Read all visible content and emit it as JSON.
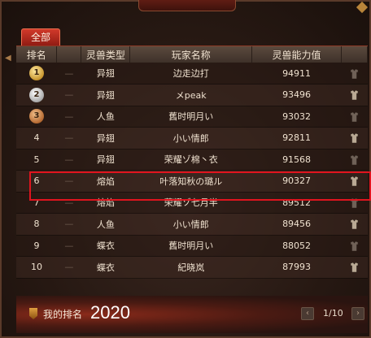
{
  "tabs": [
    {
      "label": "全部"
    }
  ],
  "table": {
    "headers": {
      "rank": "排名",
      "type": "灵兽类型",
      "player": "玩家名称",
      "power": "灵兽能力值"
    },
    "rows": [
      {
        "rank": "1",
        "dash": "—",
        "type": "异翅",
        "player": "边走边打",
        "power": "94911",
        "medal": "gold"
      },
      {
        "rank": "2",
        "dash": "—",
        "type": "异翅",
        "player": "メpeak",
        "power": "93496",
        "medal": "silver"
      },
      {
        "rank": "3",
        "dash": "—",
        "type": "人鱼",
        "player": "舊时明月い",
        "power": "93032",
        "medal": "bronze"
      },
      {
        "rank": "4",
        "dash": "—",
        "type": "异翅",
        "player": "小い情郎",
        "power": "92811",
        "medal": ""
      },
      {
        "rank": "5",
        "dash": "—",
        "type": "异翅",
        "player": "荣耀ゾ棉丶衣",
        "power": "91568",
        "medal": ""
      },
      {
        "rank": "6",
        "dash": "—",
        "type": "熔焰",
        "player": "叶落知秋の璐ル",
        "power": "90327",
        "medal": ""
      },
      {
        "rank": "7",
        "dash": "—",
        "type": "熔焰",
        "player": "荣耀ゾ七月半",
        "power": "89512",
        "medal": ""
      },
      {
        "rank": "8",
        "dash": "—",
        "type": "人鱼",
        "player": "小い情郎",
        "power": "89456",
        "medal": ""
      },
      {
        "rank": "9",
        "dash": "—",
        "type": "蝶衣",
        "player": "舊时明月い",
        "power": "88052",
        "medal": ""
      },
      {
        "rank": "10",
        "dash": "—",
        "type": "蝶衣",
        "player": "紀晓岚",
        "power": "87993",
        "medal": ""
      }
    ],
    "highlighted_rank": "6"
  },
  "footer": {
    "my_rank_label": "我的排名",
    "my_rank_value": "2020",
    "pager": "1/10",
    "prev_icon": "chevron-left-icon",
    "next_icon": "chevron-right-icon"
  },
  "colors": {
    "accent": "#d13a2a",
    "highlight_border": "#e0141e"
  }
}
